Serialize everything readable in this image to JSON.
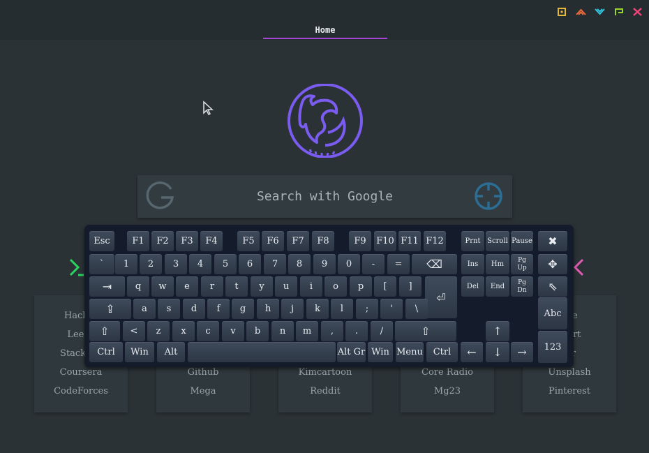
{
  "tab": {
    "home": "Home"
  },
  "search": {
    "placeholder": "Search with Google"
  },
  "cards": [
    {
      "items": [
        "Hacker",
        "LeetC",
        "Stackove",
        "Coursera",
        "CodeForces"
      ]
    },
    {
      "items": [
        "Github",
        "Mega"
      ]
    },
    {
      "items": [
        "Kimcartoon",
        "Reddit"
      ]
    },
    {
      "items": [
        "Core Radio",
        "Mg23"
      ]
    },
    {
      "items": [
        "nce",
        "ntart",
        "olr",
        "Unsplash",
        "Pinterest"
      ]
    }
  ],
  "keyboard": {
    "row0": [
      "Esc",
      "F1",
      "F2",
      "F3",
      "F4",
      "F5",
      "F6",
      "F7",
      "F8",
      "F9",
      "F10",
      "F11",
      "F12",
      "Prnt",
      "Scroll",
      "Pause",
      "✖"
    ],
    "row1": [
      "`",
      "1",
      "2",
      "3",
      "4",
      "5",
      "6",
      "7",
      "8",
      "9",
      "0",
      "-",
      "=",
      "⌫",
      "Ins",
      "Hm",
      "Pg Up",
      "✥"
    ],
    "row2": [
      "⇥",
      "q",
      "w",
      "e",
      "r",
      "t",
      "y",
      "u",
      "i",
      "o",
      "p",
      "[",
      "]",
      "⏎",
      "Del",
      "End",
      "Pg Dn",
      "⇖"
    ],
    "row3": [
      "⇪",
      "a",
      "s",
      "d",
      "f",
      "g",
      "h",
      "j",
      "k",
      "l",
      ";",
      "'",
      "\\",
      "Abc"
    ],
    "row4": [
      "⇧",
      "<",
      "z",
      "x",
      "c",
      "v",
      "b",
      "n",
      "m",
      ",",
      ".",
      "/",
      "⇧",
      "↑"
    ],
    "row5": [
      "Ctrl",
      "Win",
      "Alt",
      "",
      "Alt Gr",
      "Win",
      "Menu",
      "Ctrl",
      "←",
      "↓",
      "→",
      "123"
    ]
  },
  "colors": {
    "accent": "#a545d6",
    "logo": "#7b5cf0",
    "google": "#56676f",
    "target": "#2c6d93",
    "arrowLeft": "#2bd35f",
    "arrowRight": "#e35ab2"
  }
}
